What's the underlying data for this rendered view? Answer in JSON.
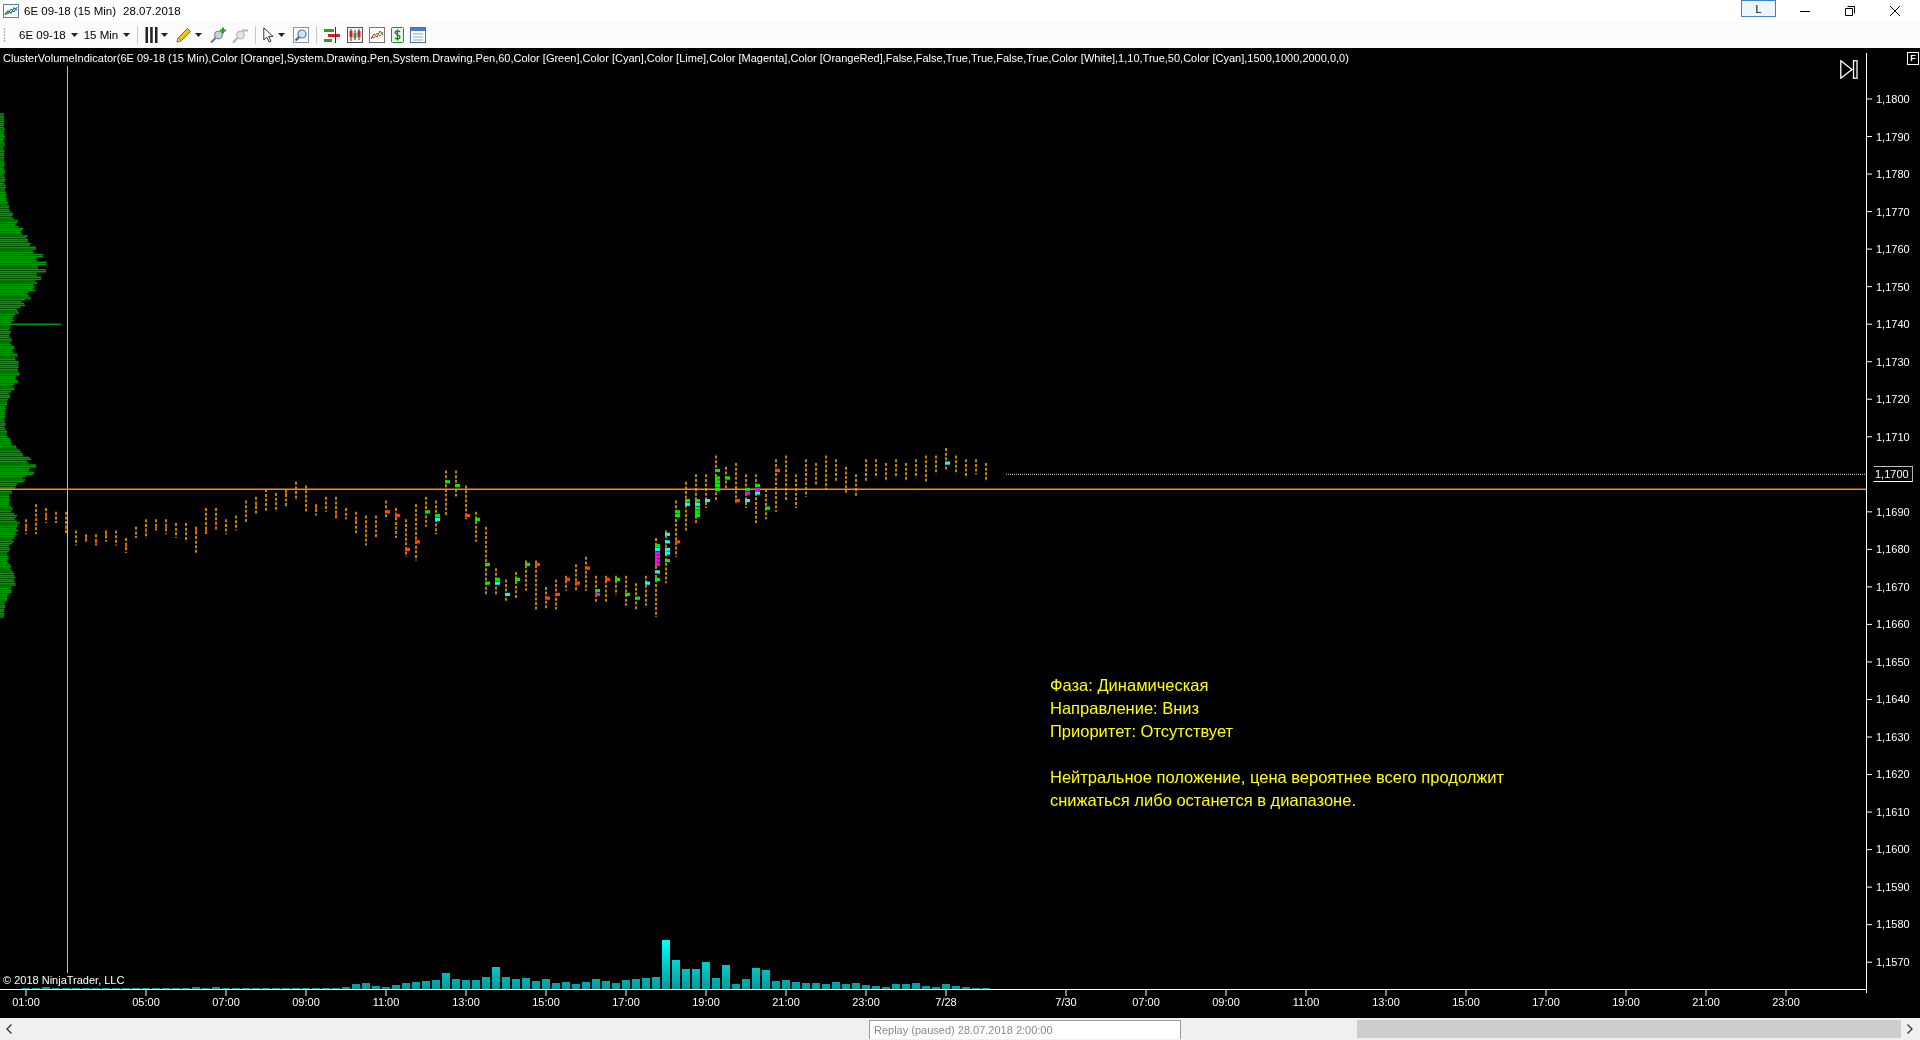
{
  "window": {
    "title": "6E 09-18 (15 Min)",
    "date": "28.07.2018",
    "title_button": "L"
  },
  "toolbar": {
    "instrument": "6E 09-18",
    "interval": "15 Min"
  },
  "chart": {
    "indicator_label": "ClusterVolumeIndicator(6E 09-18 (15 Min),Color [Orange],System.Drawing.Pen,System.Drawing.Pen,60,Color [Green],Color [Cyan],Color [Lime],Color [Magenta],Color [OrangeRed],False,False,True,True,False,True,Color [White],1,10,True,50,Color [Cyan],1500,1000,2000,0,0)",
    "corner_label": "F",
    "price_axis": [
      {
        "kind": "tick",
        "label": "1,1800"
      },
      {
        "kind": "tick",
        "label": "1,1790"
      },
      {
        "kind": "tick",
        "label": "1,1780"
      },
      {
        "kind": "tick",
        "label": "1,1770"
      },
      {
        "kind": "tick",
        "label": "1,1760"
      },
      {
        "kind": "tick",
        "label": "1,1750"
      },
      {
        "kind": "tick",
        "label": "1,1740"
      },
      {
        "kind": "tick",
        "label": "1,1730"
      },
      {
        "kind": "tick",
        "label": "1,1720"
      },
      {
        "kind": "tick",
        "label": "1,1710"
      },
      {
        "kind": "last_price",
        "label": "1,1700"
      },
      {
        "kind": "tick",
        "label": "1,1690"
      },
      {
        "kind": "tick",
        "label": "1,1680"
      },
      {
        "kind": "tick",
        "label": "1,1670"
      },
      {
        "kind": "tick",
        "label": "1,1660"
      },
      {
        "kind": "tick",
        "label": "1,1650"
      },
      {
        "kind": "tick",
        "label": "1,1640"
      },
      {
        "kind": "tick",
        "label": "1,1630"
      },
      {
        "kind": "tick",
        "label": "1,1620"
      },
      {
        "kind": "tick",
        "label": "1,1610"
      },
      {
        "kind": "tick",
        "label": "1,1600"
      },
      {
        "kind": "tick",
        "label": "1,1590"
      },
      {
        "kind": "tick",
        "label": "1,1580"
      },
      {
        "kind": "tick",
        "label": "1,1570"
      }
    ],
    "time_axis": [
      "01:00",
      "05:00",
      "07:00",
      "09:00",
      "11:00",
      "13:00",
      "15:00",
      "17:00",
      "19:00",
      "21:00",
      "23:00",
      "7/28",
      "7/30",
      "07:00",
      "09:00",
      "11:00",
      "13:00",
      "15:00",
      "17:00",
      "19:00",
      "21:00",
      "23:00"
    ],
    "copyright": "© 2018 NinjaTrader, LLC",
    "analysis": {
      "lines": [
        "Фаза: Динамическая",
        "Направление: Вниз",
        "Приоритет: Отсутствует"
      ],
      "paragraph": "Нейтральное положение, цена вероятнее всего продолжит снижаться либо останется в диапазоне."
    }
  },
  "status_bar": {
    "replay_tooltip": "Replay (paused) 28.07.2018 2:00:00"
  }
}
